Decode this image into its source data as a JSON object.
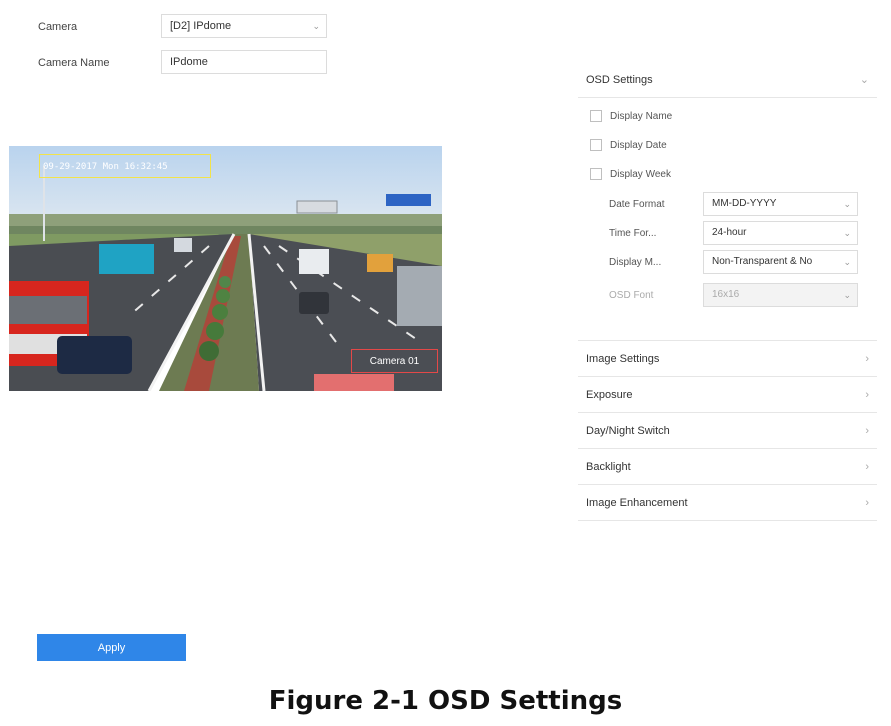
{
  "camera_row": {
    "label": "Camera",
    "value": "[D2] IPdome"
  },
  "camera_name_row": {
    "label": "Camera Name",
    "value": "IPdome"
  },
  "preview": {
    "osd_datetime": "09-29-2017 Mon 16:32:45",
    "osd_camera_name": "Camera 01"
  },
  "osd_section": {
    "title": "OSD Settings",
    "checkboxes": [
      {
        "label": "Display Name",
        "checked": false
      },
      {
        "label": "Display Date",
        "checked": false
      },
      {
        "label": "Display Week",
        "checked": false
      }
    ],
    "fields": [
      {
        "label": "Date Format",
        "value": "MM-DD-YYYY"
      },
      {
        "label": "Time For...",
        "value": "24-hour"
      },
      {
        "label": "Display M...",
        "value": "Non-Transparent & No"
      },
      {
        "label": "OSD Font",
        "value": "16x16",
        "disabled": true
      }
    ]
  },
  "sections": [
    {
      "title": "Image Settings"
    },
    {
      "title": "Exposure"
    },
    {
      "title": "Day/Night Switch"
    },
    {
      "title": "Backlight"
    },
    {
      "title": "Image Enhancement"
    }
  ],
  "apply_label": "Apply",
  "caption": "Figure 2-1 OSD Settings"
}
